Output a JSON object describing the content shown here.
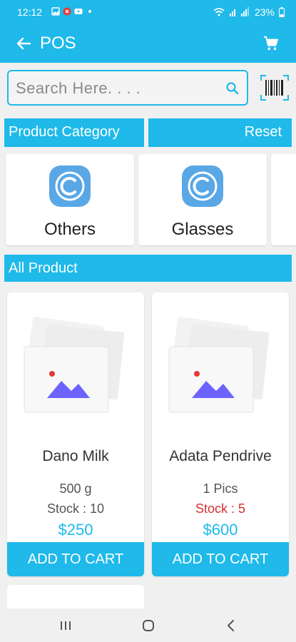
{
  "status_bar": {
    "time": "12:12",
    "battery": "23%"
  },
  "app_bar": {
    "title": "POS"
  },
  "search": {
    "placeholder": "Search Here. . . ."
  },
  "category_header": {
    "title": "Product Category",
    "reset_label": "Reset"
  },
  "categories": [
    {
      "name": "Others"
    },
    {
      "name": "Glasses"
    }
  ],
  "products_header": {
    "title": "All Product"
  },
  "products": [
    {
      "name": "Dano Milk",
      "unit": "500 g",
      "stock": "Stock : 10",
      "price": "$250",
      "button": "ADD TO CART"
    },
    {
      "name": "Adata Pendrive",
      "unit": "1 Pics",
      "stock": "Stock : 5",
      "price": "$600",
      "button": "ADD TO CART"
    }
  ],
  "colors": {
    "primary": "#1fb9ea",
    "low_stock": "#d32f2f",
    "placeholder_image": "#6c63ff"
  },
  "icons": [
    "back-arrow-icon",
    "cart-icon",
    "search-icon",
    "barcode-icon",
    "category-icon",
    "image-placeholder-icon"
  ]
}
